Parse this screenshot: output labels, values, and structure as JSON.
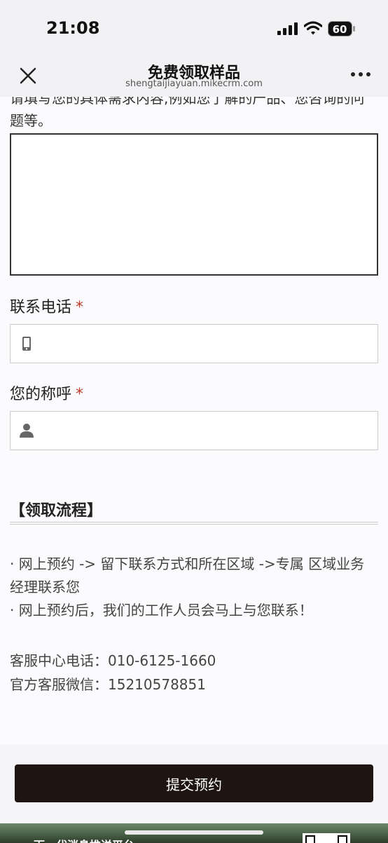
{
  "status": {
    "time": "21:08",
    "battery": "60"
  },
  "nav": {
    "title": "免费领取样品",
    "url": "shengtaijiayuan.mikecrm.com"
  },
  "form": {
    "description": "请填写您的具体需求内容,例如您了解的产品、您咨询的问题等。",
    "phone_label": "联系电话",
    "name_label": "您的称呼",
    "required_mark": "*"
  },
  "flow": {
    "title": "【领取流程】",
    "line1": "· 网上预约 -> 留下联系方式和所在区域 ->专属 区域业务经理联系您",
    "line2": "· 网上预约后，我们的工作人员会马上与您联系！"
  },
  "contact": {
    "phone": "客服中心电话：010-6125-1660",
    "wechat": "官方客服微信：15210578851"
  },
  "submit_label": "提交预约",
  "banner_text": "下一代消息推送平台"
}
